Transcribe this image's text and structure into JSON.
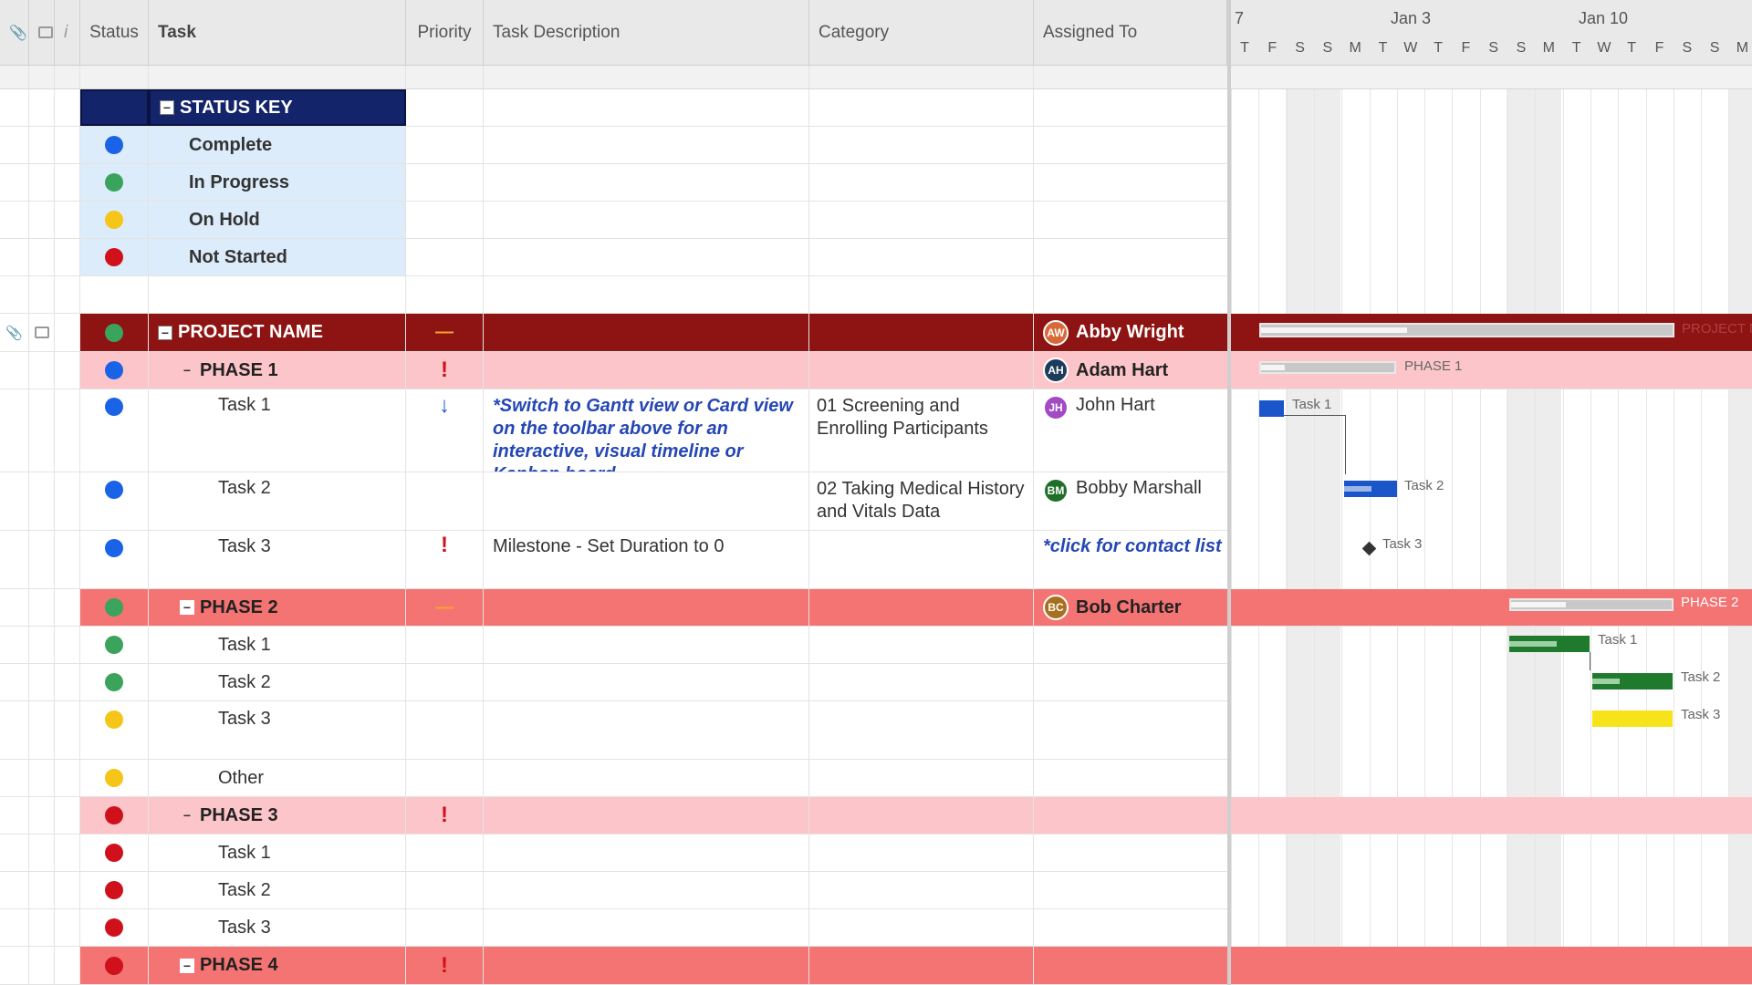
{
  "header": {
    "status": "Status",
    "task": "Task",
    "priority": "Priority",
    "description": "Task Description",
    "category": "Category",
    "assigned": "Assigned To",
    "info_icon": "i"
  },
  "gantt_header": {
    "months": [
      "7",
      "Jan 3",
      "Jan 10"
    ],
    "days": [
      "T",
      "F",
      "S",
      "S",
      "M",
      "T",
      "W",
      "T",
      "F",
      "S",
      "S",
      "M",
      "T",
      "W",
      "T",
      "F",
      "S",
      "S",
      "M"
    ]
  },
  "status_key": {
    "title": "STATUS KEY",
    "items": [
      {
        "label": "Complete",
        "color": "blue"
      },
      {
        "label": "In Progress",
        "color": "green"
      },
      {
        "label": "On Hold",
        "color": "yellow"
      },
      {
        "label": "Not Started",
        "color": "red"
      }
    ]
  },
  "project": {
    "name": "PROJECT NAME",
    "priority": "—",
    "assignee": "Abby Wright",
    "assignee_initials": "AW",
    "gantt_label": "PROJECT N"
  },
  "phase1": {
    "name": "PHASE 1",
    "priority": "!",
    "assignee": "Adam Hart",
    "initials": "AH",
    "gantt_label": "PHASE 1",
    "tasks": [
      {
        "name": "Task 1",
        "priority": "↓",
        "description": "*Switch to Gantt view or Card view on the toolbar above for an interactive, visual timeline or Kanban board.",
        "category": "01 Screening and Enrolling Participants",
        "assignee": "John Hart",
        "initials": "JH",
        "gantt_label": "Task 1"
      },
      {
        "name": "Task 2",
        "priority": "",
        "description": "",
        "category": "02 Taking Medical History and Vitals Data",
        "assignee": "Bobby Marshall",
        "initials": "BM",
        "gantt_label": "Task 2"
      },
      {
        "name": "Task 3",
        "priority": "!",
        "description": "Milestone - Set Duration to 0",
        "category": "",
        "assignee": "*click for contact list",
        "gantt_label": "Task 3"
      }
    ]
  },
  "phase2": {
    "name": "PHASE 2",
    "priority": "—",
    "assignee": "Bob Charter",
    "initials": "BC",
    "gantt_label": "PHASE 2",
    "tasks": [
      {
        "name": "Task 1",
        "gantt_label": "Task 1"
      },
      {
        "name": "Task 2",
        "gantt_label": "Task 2"
      },
      {
        "name": "Task 3",
        "gantt_label": "Task 3"
      },
      {
        "name": "Other"
      }
    ]
  },
  "phase3": {
    "name": "PHASE 3",
    "priority": "!",
    "tasks": [
      {
        "name": "Task 1"
      },
      {
        "name": "Task 2"
      },
      {
        "name": "Task 3"
      }
    ]
  },
  "phase4": {
    "name": "PHASE 4",
    "priority": "!"
  },
  "colors": {
    "project_row": "#8e1313",
    "status_key_header": "#13246b",
    "status_key_bg": "#dcecfa",
    "phase_light": "#fcc5c9",
    "phase_dark": "#f47373",
    "gantt_blue": "#1a56c9",
    "gantt_green": "#1f7a2e",
    "gantt_yellow": "#f7e31a"
  }
}
